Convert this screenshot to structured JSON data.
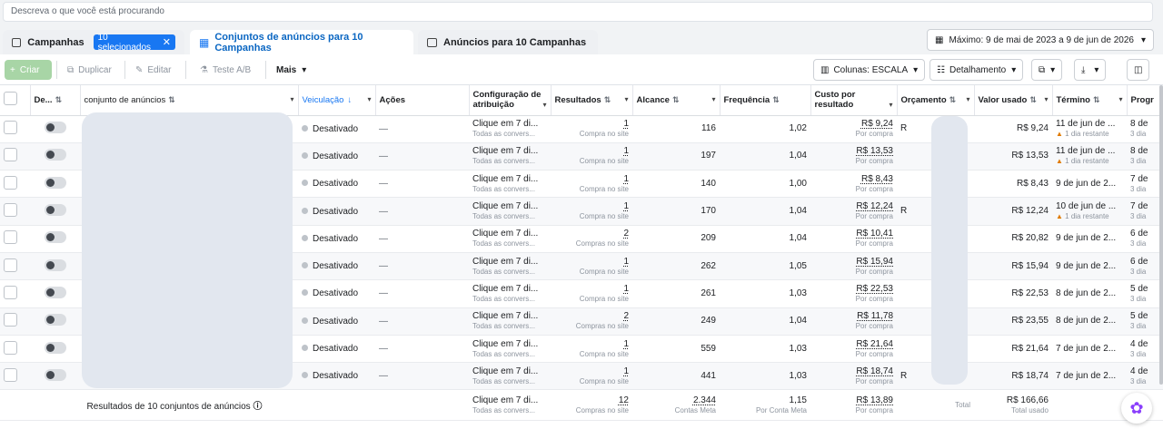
{
  "search": {
    "placeholder": "Descreva o que você está procurando"
  },
  "tabs": {
    "campaigns": "Campanhas",
    "selected_badge": "10 selecionados",
    "adsets": "Conjuntos de anúncios para 10 Campanhas",
    "ads": "Anúncios para 10 Campanhas"
  },
  "date_range": "Máximo: 9 de mai de 2023 a 9 de jun de 2026",
  "toolbar": {
    "create": "Criar",
    "duplicate": "Duplicar",
    "edit": "Editar",
    "ab_test": "Teste A/B",
    "more": "Mais",
    "columns": "Colunas: ESCALA",
    "breakdown": "Detalhamento"
  },
  "columns": {
    "off_on": "De...",
    "adset": "conjunto de anúncios",
    "delivery": "Veiculação",
    "actions": "Ações",
    "attribution": "Configuração de atribuição",
    "results": "Resultados",
    "reach": "Alcance",
    "frequency": "Frequência",
    "cost_per_result": "Custo por resultado",
    "budget": "Orçamento",
    "amount_spent": "Valor usado",
    "end": "Término",
    "progress": "Progr"
  },
  "rows": [
    {
      "delivery": "Desativado",
      "action": "—",
      "attr": "Clique em 7 di...",
      "attr_sub": "Todas as convers...",
      "results": "1",
      "results_sub": "Compra no site",
      "reach": "116",
      "freq": "1,02",
      "cost": "R$ 9,24",
      "cost_sub": "Por compra",
      "budget": "R",
      "spent": "R$ 9,24",
      "end": "11 de jun de ...",
      "end_warn": "1 dia restante",
      "prog": "8 de",
      "prog_sub": "3 dia"
    },
    {
      "delivery": "Desativado",
      "action": "—",
      "attr": "Clique em 7 di...",
      "attr_sub": "Todas as convers...",
      "results": "1",
      "results_sub": "Compra no site",
      "reach": "197",
      "freq": "1,04",
      "cost": "R$ 13,53",
      "cost_sub": "Por compra",
      "budget": "",
      "spent": "R$ 13,53",
      "end": "11 de jun de ...",
      "end_warn": "1 dia restante",
      "prog": "8 de",
      "prog_sub": "3 dia"
    },
    {
      "delivery": "Desativado",
      "action": "—",
      "attr": "Clique em 7 di...",
      "attr_sub": "Todas as convers...",
      "results": "1",
      "results_sub": "Compra no site",
      "reach": "140",
      "freq": "1,00",
      "cost": "R$ 8,43",
      "cost_sub": "Por compra",
      "budget": "",
      "spent": "R$ 8,43",
      "end": "9 de jun de 2...",
      "end_warn": "",
      "prog": "7 de",
      "prog_sub": "3 dia"
    },
    {
      "delivery": "Desativado",
      "action": "—",
      "attr": "Clique em 7 di...",
      "attr_sub": "Todas as convers...",
      "results": "1",
      "results_sub": "Compra no site",
      "reach": "170",
      "freq": "1,04",
      "cost": "R$ 12,24",
      "cost_sub": "Por compra",
      "budget": "R",
      "spent": "R$ 12,24",
      "end": "10 de jun de ...",
      "end_warn": "1 dia restante",
      "prog": "7 de",
      "prog_sub": "3 dia"
    },
    {
      "delivery": "Desativado",
      "action": "—",
      "attr": "Clique em 7 di...",
      "attr_sub": "Todas as convers...",
      "results": "2",
      "results_sub": "Compras no site",
      "reach": "209",
      "freq": "1,04",
      "cost": "R$ 10,41",
      "cost_sub": "Por compra",
      "budget": "",
      "spent": "R$ 20,82",
      "end": "9 de jun de 2...",
      "end_warn": "",
      "prog": "6 de",
      "prog_sub": "3 dia"
    },
    {
      "delivery": "Desativado",
      "action": "—",
      "attr": "Clique em 7 di...",
      "attr_sub": "Todas as convers...",
      "results": "1",
      "results_sub": "Compra no site",
      "reach": "262",
      "freq": "1,05",
      "cost": "R$ 15,94",
      "cost_sub": "Por compra",
      "budget": "",
      "spent": "R$ 15,94",
      "end": "9 de jun de 2...",
      "end_warn": "",
      "prog": "6 de",
      "prog_sub": "3 dia"
    },
    {
      "delivery": "Desativado",
      "action": "—",
      "attr": "Clique em 7 di...",
      "attr_sub": "Todas as convers...",
      "results": "1",
      "results_sub": "Compra no site",
      "reach": "261",
      "freq": "1,03",
      "cost": "R$ 22,53",
      "cost_sub": "Por compra",
      "budget": "",
      "spent": "R$ 22,53",
      "end": "8 de jun de 2...",
      "end_warn": "",
      "prog": "5 de",
      "prog_sub": "3 dia"
    },
    {
      "delivery": "Desativado",
      "action": "—",
      "attr": "Clique em 7 di...",
      "attr_sub": "Todas as convers...",
      "results": "2",
      "results_sub": "Compras no site",
      "reach": "249",
      "freq": "1,04",
      "cost": "R$ 11,78",
      "cost_sub": "Por compra",
      "budget": "",
      "spent": "R$ 23,55",
      "end": "8 de jun de 2...",
      "end_warn": "",
      "prog": "5 de",
      "prog_sub": "3 dia"
    },
    {
      "delivery": "Desativado",
      "action": "—",
      "attr": "Clique em 7 di...",
      "attr_sub": "Todas as convers...",
      "results": "1",
      "results_sub": "Compra no site",
      "reach": "559",
      "freq": "1,03",
      "cost": "R$ 21,64",
      "cost_sub": "Por compra",
      "budget": "",
      "spent": "R$ 21,64",
      "end": "7 de jun de 2...",
      "end_warn": "",
      "prog": "4 de",
      "prog_sub": "3 dia"
    },
    {
      "delivery": "Desativado",
      "action": "—",
      "attr": "Clique em 7 di...",
      "attr_sub": "Todas as convers...",
      "results": "1",
      "results_sub": "Compra no site",
      "reach": "441",
      "freq": "1,03",
      "cost": "R$ 18,74",
      "cost_sub": "Por compra",
      "budget": "R",
      "spent": "R$ 18,74",
      "end": "7 de jun de 2...",
      "end_warn": "",
      "prog": "4 de",
      "prog_sub": "3 dia"
    }
  ],
  "totals": {
    "label": "Resultados de 10 conjuntos de anúncios",
    "attr": "Clique em 7 di...",
    "attr_sub": "Todas as convers...",
    "results": "12",
    "results_sub": "Compras no site",
    "reach": "2.344",
    "reach_sub": "Contas Meta",
    "freq": "1,15",
    "freq_sub": "Por Conta Meta",
    "cost": "R$ 13,89",
    "cost_sub": "Por compra",
    "budget_sub": "Total",
    "spent": "R$ 166,66",
    "spent_sub": "Total usado"
  }
}
